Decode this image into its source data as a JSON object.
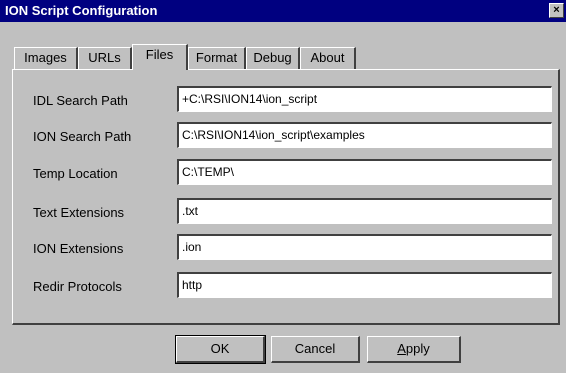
{
  "window": {
    "title": "ION Script Configuration",
    "close_glyph": "×"
  },
  "tabs": [
    {
      "label": "Images"
    },
    {
      "label": "URLs"
    },
    {
      "label": "Files",
      "active": true
    },
    {
      "label": "Format"
    },
    {
      "label": "Debug"
    },
    {
      "label": "About"
    }
  ],
  "fields": [
    {
      "label": "IDL Search Path",
      "value": "+C:\\RSI\\ION14\\ion_script"
    },
    {
      "label": "ION Search Path",
      "value": "C:\\RSI\\ION14\\ion_script\\examples"
    },
    {
      "label": "Temp Location",
      "value": "C:\\TEMP\\"
    },
    {
      "label": "Text Extensions",
      "value": ".txt"
    },
    {
      "label": "ION Extensions",
      "value": ".ion"
    },
    {
      "label": "Redir Protocols",
      "value": "http"
    }
  ],
  "buttons": {
    "ok": "OK",
    "cancel": "Cancel",
    "apply_prefix": "A",
    "apply_rest": "pply"
  },
  "colors": {
    "titlebar": "#000080",
    "face": "#c0c0c0"
  }
}
